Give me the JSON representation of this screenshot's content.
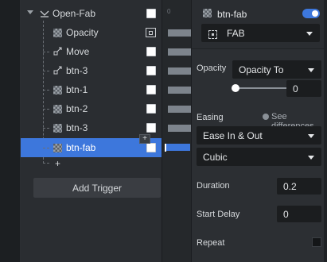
{
  "tree": {
    "rows": [
      {
        "label": "Open-Fab"
      },
      {
        "label": "Opacity"
      },
      {
        "label": "Move"
      },
      {
        "label": "btn-3"
      },
      {
        "label": "btn-1"
      },
      {
        "label": "btn-2"
      },
      {
        "label": "btn-3"
      },
      {
        "label": "btn-fab"
      }
    ],
    "add_row_label": "+",
    "add_tooltip": "+",
    "add_trigger_label": "Add Trigger"
  },
  "timeline": {
    "tick": "0"
  },
  "inspector": {
    "title": "btn-fab",
    "enabled": true,
    "target_select": "FAB",
    "opacity_label": "Opacity",
    "opacity_select": "Opacity To",
    "opacity_value": "0",
    "easing_label": "Easing",
    "see_differences": "See differences",
    "easing_select": "Ease In & Out",
    "curve_select": "Cubic",
    "duration_label": "Duration",
    "duration_value": "0.2",
    "start_delay_label": "Start Delay",
    "start_delay_value": "0",
    "repeat_label": "Repeat",
    "repeat_checked": false
  },
  "colors": {
    "accent": "#3d77dc",
    "panel": "#2a2d31",
    "field": "#1b1d1f"
  }
}
